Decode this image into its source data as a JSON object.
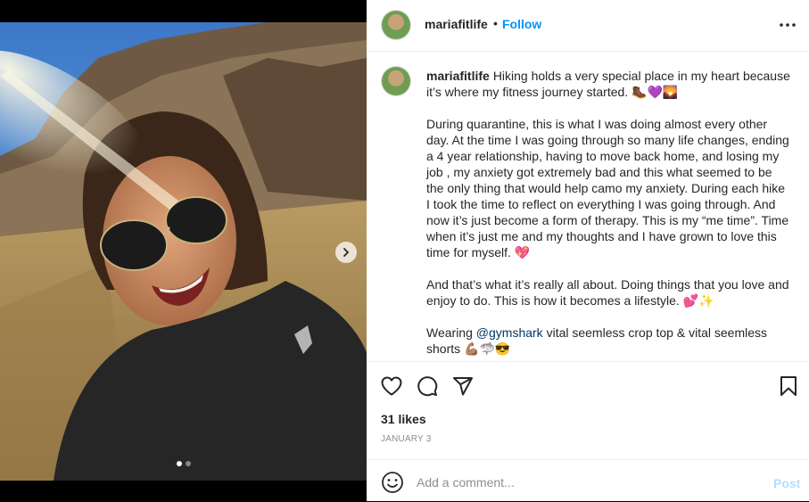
{
  "header": {
    "username": "mariafitlife",
    "separator": "•",
    "follow_label": "Follow"
  },
  "caption": {
    "username": "mariafitlife",
    "paragraphs": [
      "Hiking holds a very special place in my heart because it’s where my fitness journey started. 🥾💜🌄",
      "During quarantine, this is what I was doing almost every other day. At the time I was going through so many life changes, ending a 4 year relationship, having to move back home, and losing my job , my anxiety got extremely bad and this what seemed to be the only thing that would help camo my anxiety. During each hike I took the time to reflect on everything I was going through. And now it’s just become a form of therapy. This is my “me time”. Time when it’s just me and my thoughts and I have grown to love this time for myself. 💖",
      "And that’s what it’s really all about. Doing things that you love and enjoy to do. This is how it becomes a lifestyle. 💕✨"
    ],
    "last_paragraph": {
      "before": "Wearing ",
      "mention": "@gymshark",
      "after": " vital seemless crop top & vital seemless shorts 💪🏽🦈😎"
    }
  },
  "stats": {
    "likes": "31 likes",
    "date": "JANUARY 3"
  },
  "comment": {
    "placeholder": "Add a comment...",
    "post_label": "Post"
  },
  "media": {
    "carousel_count": 2,
    "active_index": 0
  },
  "colors": {
    "follow": "#0095f6",
    "post_disabled": "#b2dffc",
    "mention": "#00376b",
    "text": "#262626",
    "muted": "#8e8e8e"
  }
}
